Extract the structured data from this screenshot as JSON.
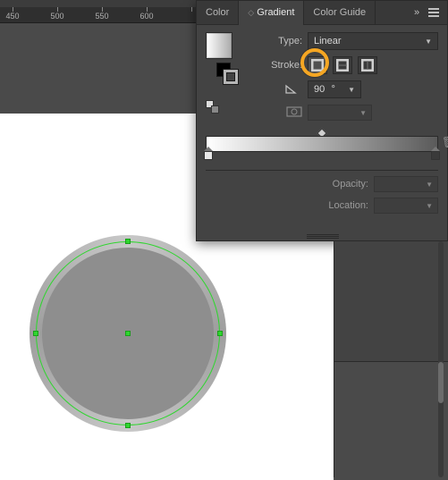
{
  "ruler": {
    "labels": [
      450,
      500,
      550,
      600
    ]
  },
  "tabs": {
    "color": "Color",
    "gradient": "Gradient",
    "guide": "Color Guide",
    "expand_glyph": "»"
  },
  "gradient": {
    "type_label": "Type:",
    "type_value": "Linear",
    "stroke_label": "Stroke:",
    "angle_value": "90",
    "opacity_label": "Opacity:",
    "location_label": "Location:"
  },
  "colors": {
    "accent": "#f5a623",
    "selection": "#2fd62f"
  }
}
